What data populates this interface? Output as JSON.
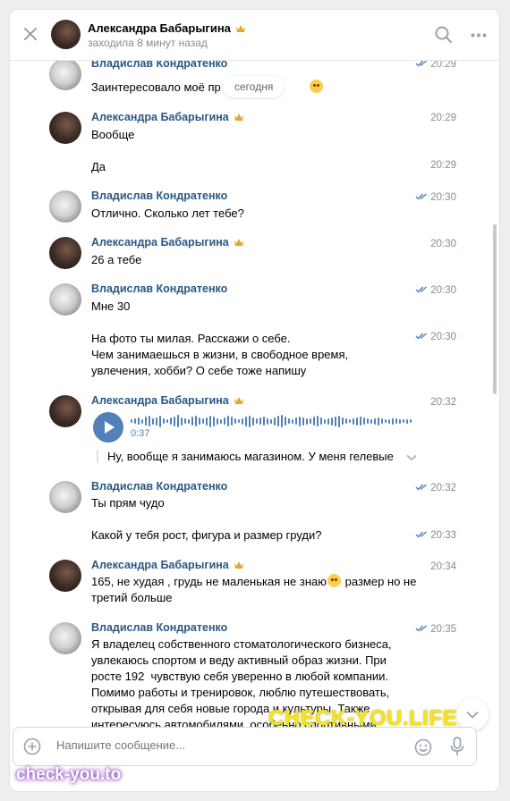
{
  "header": {
    "contact_name": "Александра Бабарыгина",
    "status": "заходила 8 минут назад"
  },
  "date_pill": "сегодня",
  "messages": [
    {
      "sender": "Владислав Кондратенко",
      "time": "20:29",
      "text": "Заинтересовало моё пр"
    },
    {
      "sender": "Александра Бабарыгина",
      "time": "20:29",
      "text": "Вообще"
    },
    {
      "time": "20:29",
      "text": "Да"
    },
    {
      "sender": "Владислав Кондратенко",
      "time": "20:30",
      "text": "Отлично. Сколько лет тебе?"
    },
    {
      "sender": "Александра Бабарыгина",
      "time": "20:30",
      "text": "26 а тебе"
    },
    {
      "sender": "Владислав Кондратенко",
      "time": "20:30",
      "text": "Мне 30"
    },
    {
      "time": "20:30",
      "text": "На фото ты милая. Расскажи о себе.\nЧем занимаешься в жизни, в свободное время,\nувлечения, хобби? О себе тоже напишу"
    },
    {
      "sender": "Александра Бабарыгина",
      "time": "20:32",
      "voice_duration": "0:37",
      "transcript": "Ну, вообще я занимаюсь магазином. У меня гелевые"
    },
    {
      "sender": "Владислав Кондратенко",
      "time": "20:32",
      "text": "Ты прям чудо"
    },
    {
      "time": "20:33",
      "text": "Какой у тебя рост, фигура и размер груди?"
    },
    {
      "sender": "Александра Бабарыгина",
      "time": "20:34",
      "text_a": "165, не худая , грудь не маленькая не знаю",
      "text_b": " размер но не\nтретий больше"
    },
    {
      "sender": "Владислав Кондратенко",
      "time": "20:35",
      "text": "Я владелец собственного стоматологического бизнеса,\nувлекаюсь спортом и веду активный образ жизни. При\nросте 192  чувствую себя уверенно в любой компании.\nПомимо работы и тренировок, люблю путешествовать,\nоткрывая для себя новые города и культуры. Также\nинтересуюсь автомобилями, особенно спортивными\nмоделями, и не упускаю возможность протестировать"
    }
  ],
  "composer": {
    "placeholder": "Напишите сообщение..."
  },
  "watermarks": {
    "main": "CHECK-YOU.LIFE",
    "corner": "check-you.to"
  },
  "colors": {
    "name_link": "#2a5885",
    "accent": "#5181b8",
    "muted": "#818c99",
    "watermark_yellow": "#f5e320"
  },
  "voice_level": 0.0
}
